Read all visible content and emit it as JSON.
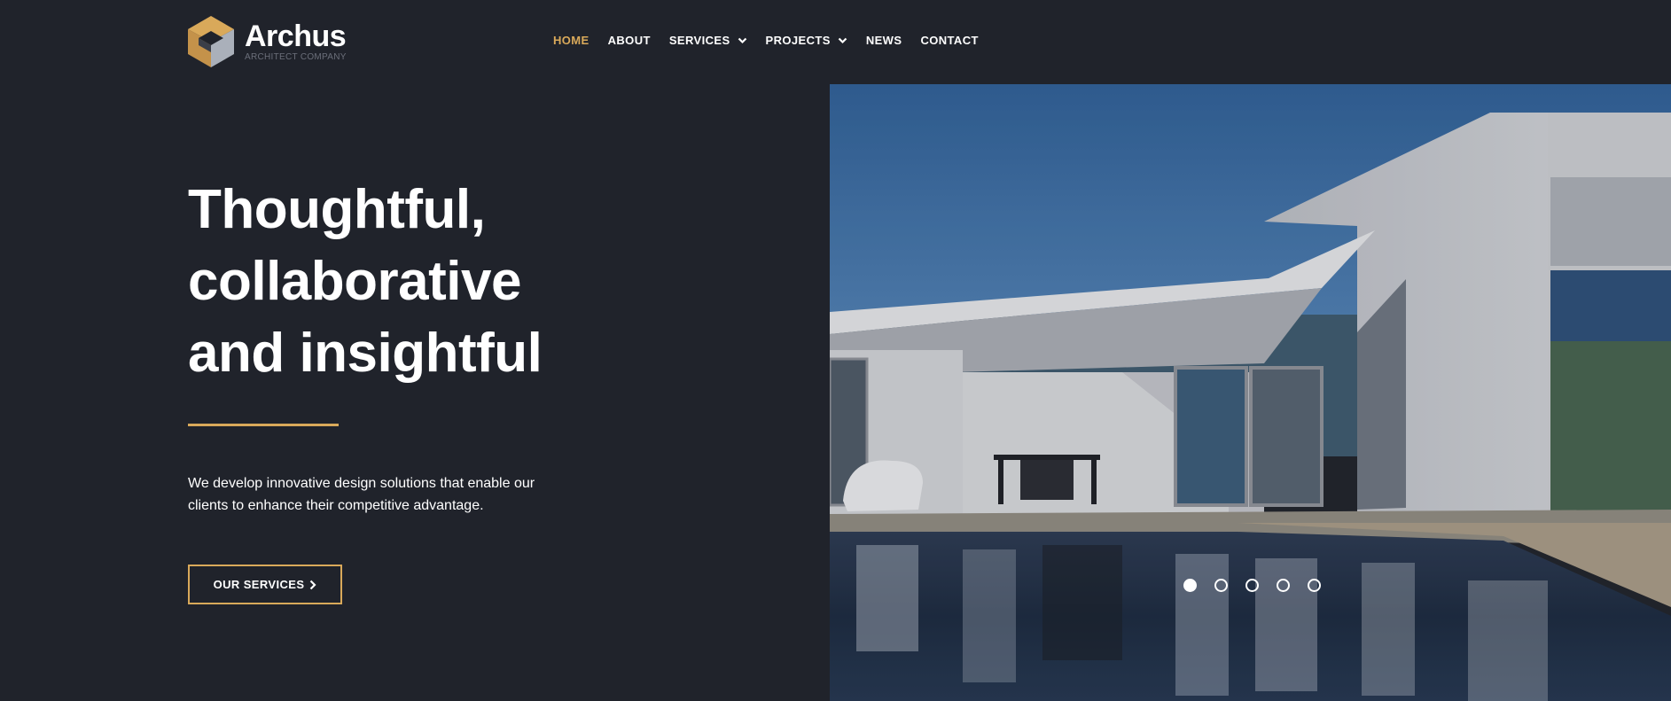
{
  "brand": {
    "name": "Archus",
    "tagline": "ARCHITECT COMPANY",
    "accent_color": "#d9a95a",
    "background_color": "#20232b"
  },
  "nav": {
    "items": [
      {
        "label": "HOME",
        "active": true,
        "dropdown": false
      },
      {
        "label": "ABOUT",
        "active": false,
        "dropdown": false
      },
      {
        "label": "SERVICES",
        "active": false,
        "dropdown": true
      },
      {
        "label": "PROJECTS",
        "active": false,
        "dropdown": true
      },
      {
        "label": "NEWS",
        "active": false,
        "dropdown": false
      },
      {
        "label": "CONTACT",
        "active": false,
        "dropdown": false
      }
    ]
  },
  "hero": {
    "title_lines": [
      "Thoughtful,",
      "collaborative",
      "and insightful"
    ],
    "description": "We develop innovative design solutions that enable our clients to enhance their competitive advantage.",
    "cta_label": "OUR SERVICES",
    "cta_icon": "chevron-right-icon"
  },
  "slider": {
    "image_subject": "modern white house with pool",
    "slide_count": 5,
    "active_slide": 1
  }
}
